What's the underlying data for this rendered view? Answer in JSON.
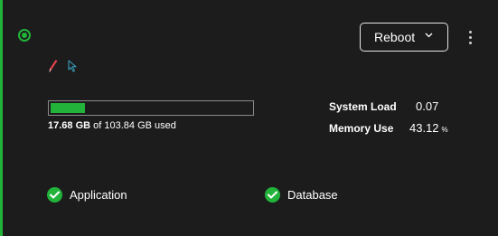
{
  "colors": {
    "accent": "#22b33a",
    "background": "#1c1c1c"
  },
  "status": {
    "icon": "status-online-icon"
  },
  "tools": [
    {
      "icon": "pencil-icon",
      "color": "#e0424b"
    },
    {
      "icon": "cursor-pointer-icon",
      "color": "#3aa3c4"
    }
  ],
  "reboot": {
    "label": "Reboot",
    "icon": "chevron-down-icon"
  },
  "more_menu": {
    "icon": "more-vertical-icon"
  },
  "storage": {
    "used": "17.68 GB",
    "of_text": " of ",
    "total": "103.84 GB",
    "suffix": " used",
    "fraction": 0.17
  },
  "stats": [
    {
      "label": "System Load",
      "value": "0.07",
      "unit": ""
    },
    {
      "label": "Memory Use",
      "value": "43.12",
      "unit": "%"
    }
  ],
  "services": [
    {
      "name": "Application",
      "icon": "check-circle-icon"
    },
    {
      "name": "Database",
      "icon": "check-circle-icon"
    }
  ]
}
